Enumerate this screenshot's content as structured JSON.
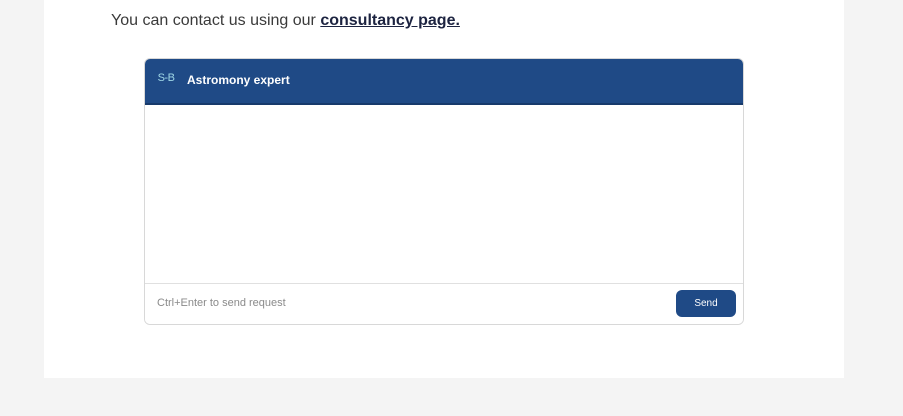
{
  "contact": {
    "text": "You can contact us using our ",
    "link_label": "consultancy page."
  },
  "chat": {
    "logo_text": "S-B",
    "title": "Astromony expert",
    "input_placeholder": "Ctrl+Enter to send request",
    "input_value": "",
    "send_label": "Send"
  },
  "colors": {
    "header_bg": "#1f4a86",
    "send_button_bg": "#1f4a86",
    "page_bg": "#f4f4f4",
    "content_bg": "#ffffff"
  }
}
